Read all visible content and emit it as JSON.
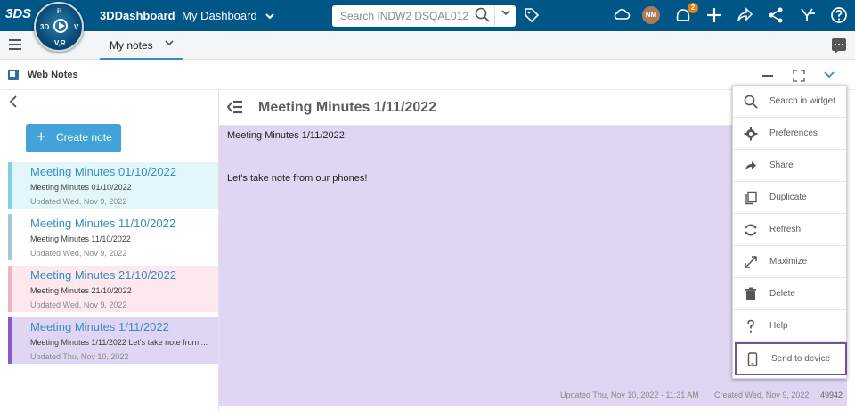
{
  "topbar": {
    "brand": "3DDashboard",
    "dashboard": "My Dashboard",
    "search_placeholder": "Search INDW2 DSQAL012",
    "avatar_initials": "NM",
    "notification_count": "2",
    "compass_letters": {
      "top": "i³",
      "left": "3D",
      "right": "V",
      "bottom": "V,R"
    },
    "colors": {
      "bar": "#005686",
      "accent": "#368ec4",
      "badge": "#e87b15"
    }
  },
  "tabbar": {
    "active_tab": "My notes"
  },
  "widget": {
    "title": "Web Notes"
  },
  "left_panel": {
    "create_button": "Create note",
    "notes": [
      {
        "title": "Meeting Minutes 01/10/2022",
        "preview": "Meeting Minutes 01/10/2022",
        "updated": "Updated Wed, Nov 9, 2022",
        "color": "#7fd3e0",
        "bg": "#e3f7fb"
      },
      {
        "title": "Meeting Minutes 11/10/2022",
        "preview": "Meeting Minutes 11/10/2022",
        "updated": "Updated Wed, Nov 9, 2022",
        "color": "#a8c7de",
        "bg": "#ffffff"
      },
      {
        "title": "Meeting Minutes 21/10/2022",
        "preview": "Meeting Minutes 21/10/2022",
        "updated": "Updated Wed, Nov 9, 2022",
        "color": "#f3b3c2",
        "bg": "#fde8ee"
      },
      {
        "title": "Meeting Minutes 1/11/2022",
        "preview": "Meeting Minutes 1/11/2022 Let's take note from ...",
        "updated": "Updated Thu, Nov 10, 2022",
        "color": "#8a5bc6",
        "bg": "#e0d6f3"
      }
    ]
  },
  "editor": {
    "title": "Meeting Minutes 1/11/2022",
    "line1": "Meeting Minutes 1/11/2022",
    "line2": "Let's take note from our phones!",
    "footer_updated": "Updated Thu, Nov 10, 2022 - 11:31 AM",
    "footer_created": "Created Wed, Nov 9, 2022",
    "footer_id": "49942"
  },
  "menu": {
    "items": [
      {
        "label": "Search in widget",
        "icon": "search-icon"
      },
      {
        "label": "Preferences",
        "icon": "gear-icon"
      },
      {
        "label": "Share",
        "icon": "share-arrow-icon"
      },
      {
        "label": "Duplicate",
        "icon": "duplicate-icon"
      },
      {
        "label": "Refresh",
        "icon": "refresh-icon"
      },
      {
        "label": "Maximize",
        "icon": "maximize-icon"
      },
      {
        "label": "Delete",
        "icon": "trash-icon"
      },
      {
        "label": "Help",
        "icon": "help-icon"
      },
      {
        "label": "Send to device",
        "icon": "mobile-device-icon"
      }
    ]
  }
}
